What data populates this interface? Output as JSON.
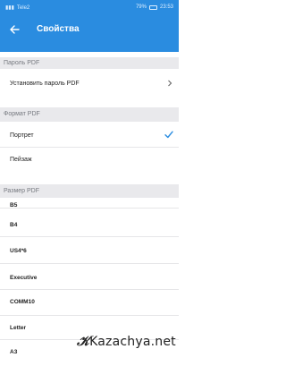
{
  "status_bar": {
    "left_text": "Tele2",
    "battery_percent": "79%",
    "time": "23:53"
  },
  "header": {
    "title": "Свойства",
    "back_icon": "arrow-left-icon"
  },
  "sections": {
    "password": {
      "header": "Пароль PDF",
      "items": [
        {
          "label": "Установить пароль PDF",
          "icon": "chevron-right-icon"
        }
      ]
    },
    "format": {
      "header": "Формат PDF",
      "items": [
        {
          "label": "Портрет",
          "selected": true
        },
        {
          "label": "Пейзаж",
          "selected": false
        }
      ]
    },
    "size": {
      "header": "Размер PDF",
      "items": [
        {
          "label": "B5"
        },
        {
          "label": "B4"
        },
        {
          "label": "US4*6"
        },
        {
          "label": "Executive"
        },
        {
          "label": "COMM10"
        },
        {
          "label": "Letter"
        },
        {
          "label": "A3"
        }
      ]
    }
  },
  "watermark": {
    "text": "Kazachya.net"
  },
  "colors": {
    "accent": "#2a8ce0",
    "section_bg": "#e9e9ec",
    "text": "#222222"
  }
}
